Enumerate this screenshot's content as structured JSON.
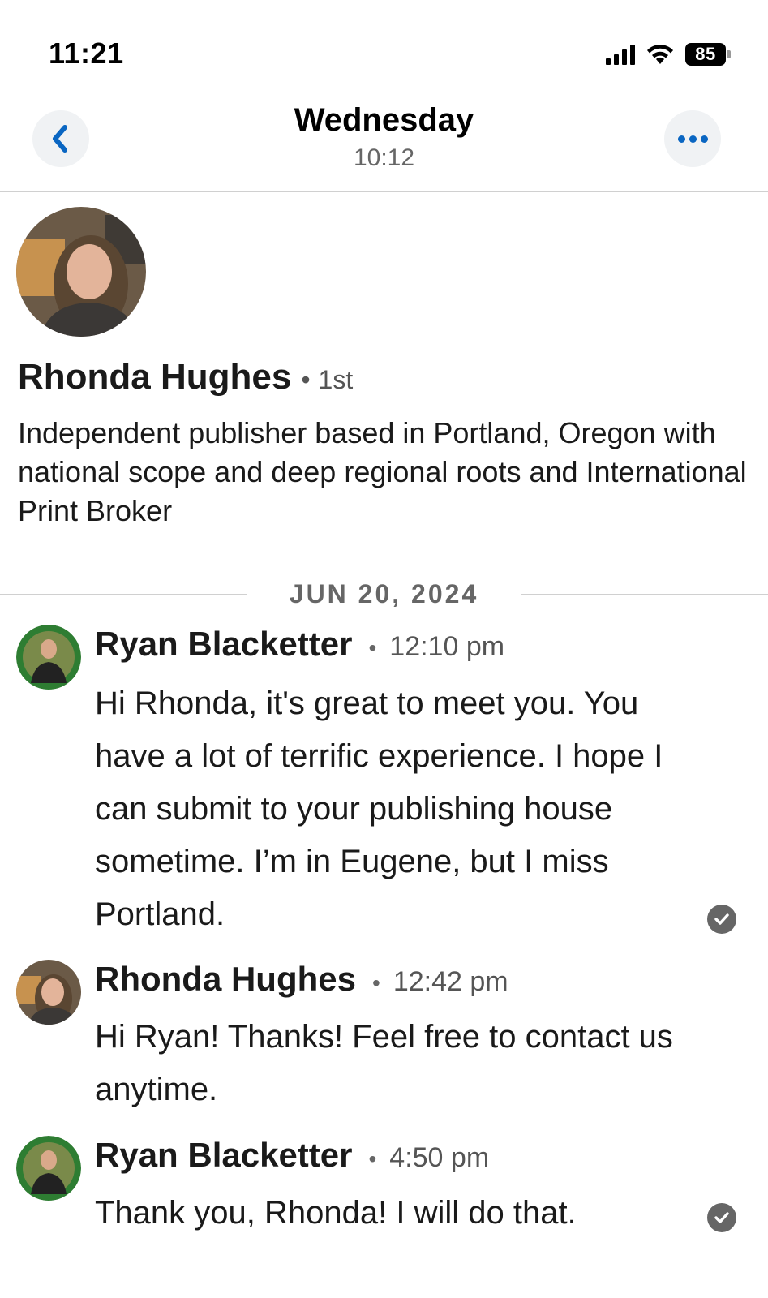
{
  "status_bar": {
    "time": "11:21",
    "battery": "85"
  },
  "header": {
    "title": "Wednesday",
    "subtitle": "10:12"
  },
  "profile": {
    "name": "Rhonda Hughes",
    "degree": "1st",
    "headline": "Independent publisher based in Portland, Oregon with national scope and deep regional roots and International Print Broker"
  },
  "conversation": {
    "date": "JUN 20, 2024",
    "messages": [
      {
        "sender": "Ryan Blacketter",
        "time": "12:10 pm",
        "body": "Hi Rhonda, it's great to meet you. You have a lot of terrific experience. I hope I can submit to your publishing house sometime. I’m in Eugene, but I miss Portland.",
        "read": true
      },
      {
        "sender": "Rhonda Hughes",
        "time": "12:42 pm",
        "body": "Hi Ryan! Thanks! Feel free to contact us anytime.",
        "read": false
      },
      {
        "sender": "Ryan Blacketter",
        "time": "4:50 pm",
        "body": "Thank you, Rhonda! I will do that.",
        "read": true
      }
    ]
  },
  "icons": {
    "back": "chevron-left-icon",
    "more": "more-horizontal-icon",
    "read_receipt": "checkmark-circle-icon"
  },
  "colors": {
    "accent": "#0a66c2",
    "open_to_work_ring": "#2e7d32"
  }
}
